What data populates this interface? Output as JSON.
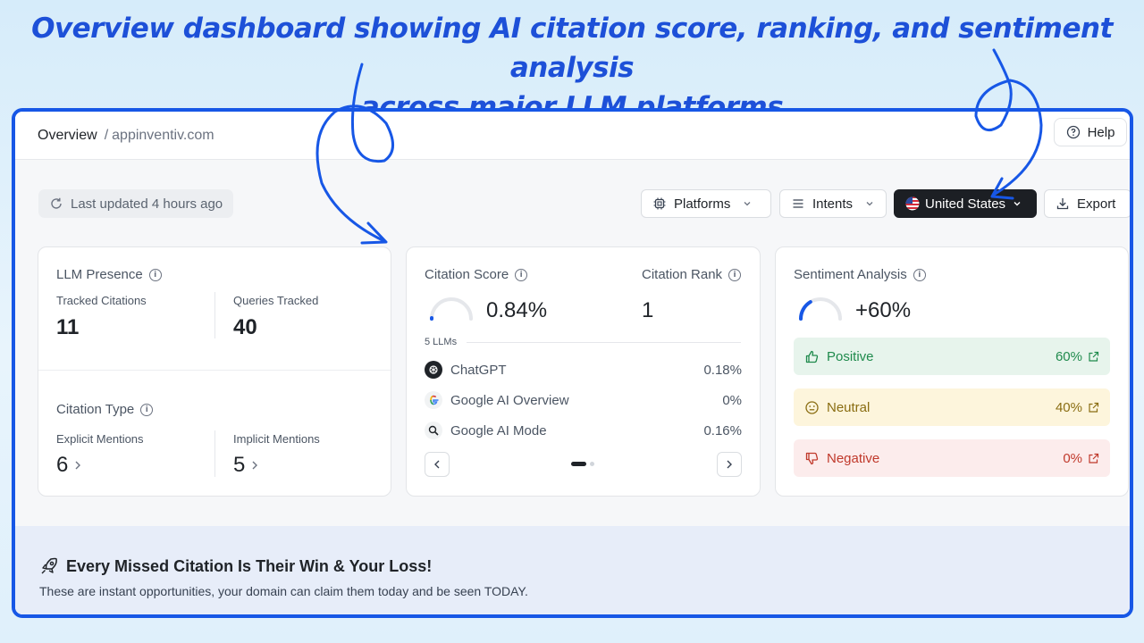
{
  "headline": {
    "line1": "Overview dashboard showing AI citation score, ranking, and sentiment analysis",
    "line2": "across major LLM platforms"
  },
  "breadcrumb": {
    "main": "Overview",
    "separator": "/",
    "domain": "appinventiv.com"
  },
  "help": {
    "label": "Help",
    "icon": "help-circle-icon"
  },
  "toolbar": {
    "last_updated": "Last updated 4 hours ago",
    "platforms": "Platforms",
    "intents": "Intents",
    "country": "United States",
    "export": "Export"
  },
  "llm_presence": {
    "title": "LLM Presence",
    "tracked_citations_label": "Tracked Citations",
    "tracked_citations_value": "11",
    "queries_tracked_label": "Queries Tracked",
    "queries_tracked_value": "40",
    "citation_type_title": "Citation Type",
    "explicit_label": "Explicit Mentions",
    "explicit_value": "6",
    "implicit_label": "Implicit Mentions",
    "implicit_value": "5"
  },
  "citation": {
    "score_title": "Citation Score",
    "score_value": "0.84%",
    "score_fraction": 0.0084,
    "rank_title": "Citation Rank",
    "rank_value": "1",
    "llm_count": "5 LLMs",
    "platforms": [
      {
        "name": "ChatGPT",
        "value": "0.18%",
        "icon": "chatgpt-icon"
      },
      {
        "name": "Google AI Overview",
        "value": "0%",
        "icon": "google-icon"
      },
      {
        "name": "Google AI Mode",
        "value": "0.16%",
        "icon": "google-ai-mode-icon"
      }
    ]
  },
  "sentiment": {
    "title": "Sentiment Analysis",
    "value": "+60%",
    "gauge_fraction": 0.6,
    "rows": [
      {
        "label": "Positive",
        "value": "60%",
        "color": "#1f8a4c",
        "bg": "#e7f4ec"
      },
      {
        "label": "Neutral",
        "value": "40%",
        "color": "#8a6d12",
        "bg": "#fdf5dc"
      },
      {
        "label": "Negative",
        "value": "0%",
        "color": "#c0392b",
        "bg": "#fcecec"
      }
    ]
  },
  "banner": {
    "title": "Every Missed Citation Is Their Win & Your Loss!",
    "subtitle": "These are instant opportunities, your domain can claim them today and be seen TODAY."
  },
  "colors": {
    "accent": "#1757e6",
    "dark_button": "#1c1f24"
  }
}
